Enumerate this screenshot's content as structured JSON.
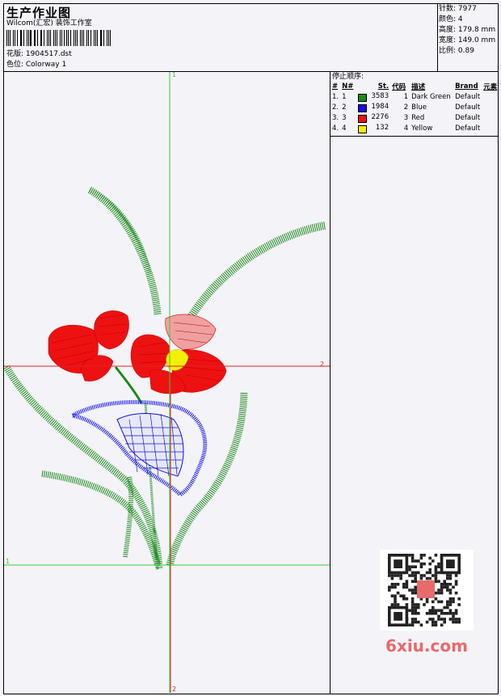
{
  "header": {
    "title": "生产作业图",
    "company": "Wilcom(汇宏) 装饰工作室",
    "design_label": "花版: 1904517.dst",
    "colorway_label": "色位: Colorway 1"
  },
  "stats": [
    {
      "label": "针数:",
      "value": "7977"
    },
    {
      "label": "颜色:",
      "value": "4"
    },
    {
      "label": "高度:",
      "value": "179.8 mm"
    },
    {
      "label": "宽度:",
      "value": "149.0 mm"
    },
    {
      "label": "比例:",
      "value": "0.89"
    }
  ],
  "stop_sequence": {
    "title": "停止顺序:",
    "columns": [
      "#",
      "N#",
      "St.",
      "代码",
      "描述",
      "Brand",
      "元素"
    ],
    "rows": [
      {
        "num": "1.",
        "n": "1",
        "color": "#1a8a1a",
        "stitches": "3583",
        "code": "1",
        "desc": "Dark Green",
        "brand": "Default"
      },
      {
        "num": "2.",
        "n": "2",
        "color": "#1010e0",
        "stitches": "1984",
        "code": "2",
        "desc": "Blue",
        "brand": "Default"
      },
      {
        "num": "3.",
        "n": "3",
        "color": "#ee1111",
        "stitches": "2276",
        "code": "3",
        "desc": "Red",
        "brand": "Default"
      },
      {
        "num": "4.",
        "n": "4",
        "color": "#f5f000",
        "stitches": "132",
        "code": "4",
        "desc": "Yellow",
        "brand": "Default"
      }
    ]
  },
  "axes": {
    "top_label": "1",
    "right_label": "2",
    "left_label": "1",
    "bottom_label": "2"
  },
  "watermark": "6xiu.com",
  "colors": {
    "green": "#1a8a1a",
    "blue": "#1010e0",
    "red": "#ee1111",
    "yellow": "#f5f000",
    "axis_green": "#33cc33",
    "axis_red": "#dd2222"
  }
}
